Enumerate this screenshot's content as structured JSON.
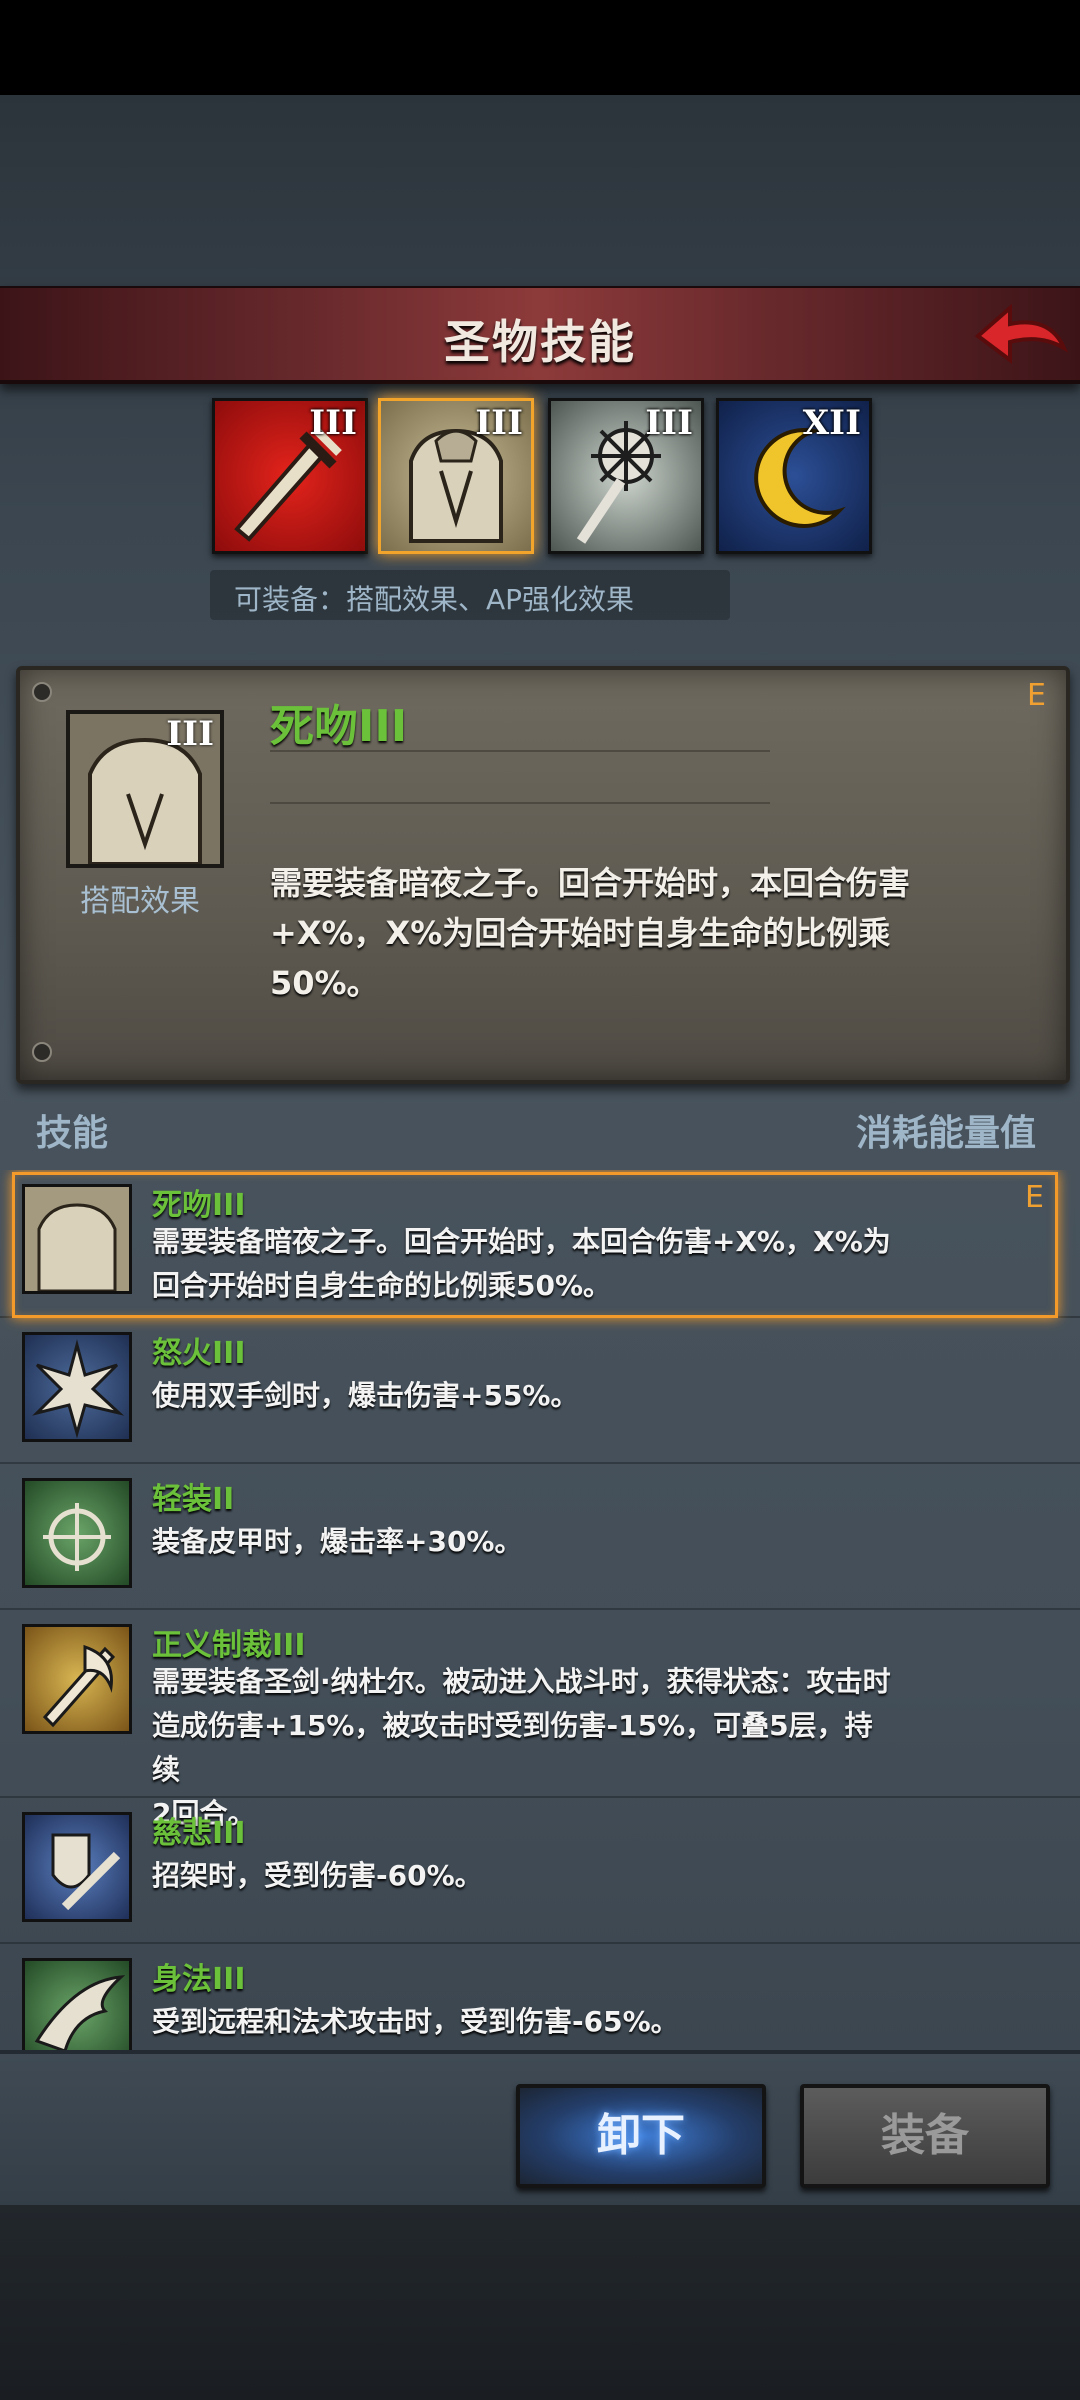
{
  "header": {
    "title": "圣物技能"
  },
  "relics": [
    {
      "rank": "III",
      "icon": "sword-icon",
      "selected": false
    },
    {
      "rank": "III",
      "icon": "headless-armor-icon",
      "selected": true
    },
    {
      "rank": "III",
      "icon": "mace-icon",
      "selected": false
    },
    {
      "rank": "XII",
      "icon": "crescent-moon-icon",
      "selected": false
    }
  ],
  "equip_info": "可装备：搭配效果、AP强化效果",
  "detail": {
    "rank": "III",
    "icon_label": "搭配效果",
    "name": "死吻III",
    "equipped_mark": "E",
    "desc_line1": "需要装备暗夜之子。回合开始时，本回合伤害",
    "desc_line2": "+X%，X%为回合开始时自身生命的比例乘",
    "desc_line3": "50%。"
  },
  "list_header": {
    "left": "技能",
    "right": "消耗能量值"
  },
  "skills": [
    {
      "name": "死吻III",
      "tag": "E",
      "icon": "headless-armor-icon",
      "desc": [
        "需要装备暗夜之子。回合开始时，本回合伤害+X%，X%为",
        "回合开始时自身生命的比例乘50%。"
      ]
    },
    {
      "name": "怒火III",
      "tag": "",
      "icon": "burst-icon",
      "desc": [
        "",
        "使用双手剑时，爆击伤害+55%。"
      ]
    },
    {
      "name": "轻装II",
      "tag": "",
      "icon": "crosshair-icon",
      "desc": [
        "",
        "装备皮甲时，爆击率+30%。"
      ]
    },
    {
      "name": "正义制裁III",
      "tag": "",
      "icon": "flame-sword-icon",
      "desc": [
        "需要装备圣剑·纳杜尔。被动进入战斗时，获得状态：攻击时",
        "造成伤害+15%，被攻击时受到伤害-15%，可叠5层，持续",
        "2回合。"
      ]
    },
    {
      "name": "慈悲III",
      "tag": "",
      "icon": "shield-sword-icon",
      "desc": [
        "",
        "招架时，受到伤害-60%。"
      ]
    },
    {
      "name": "身法III",
      "tag": "",
      "icon": "wing-icon",
      "desc": [
        "",
        "受到远程和法术攻击时，受到伤害-65%。"
      ]
    }
  ],
  "actions": {
    "unequip": "卸下",
    "equip": "装备"
  }
}
